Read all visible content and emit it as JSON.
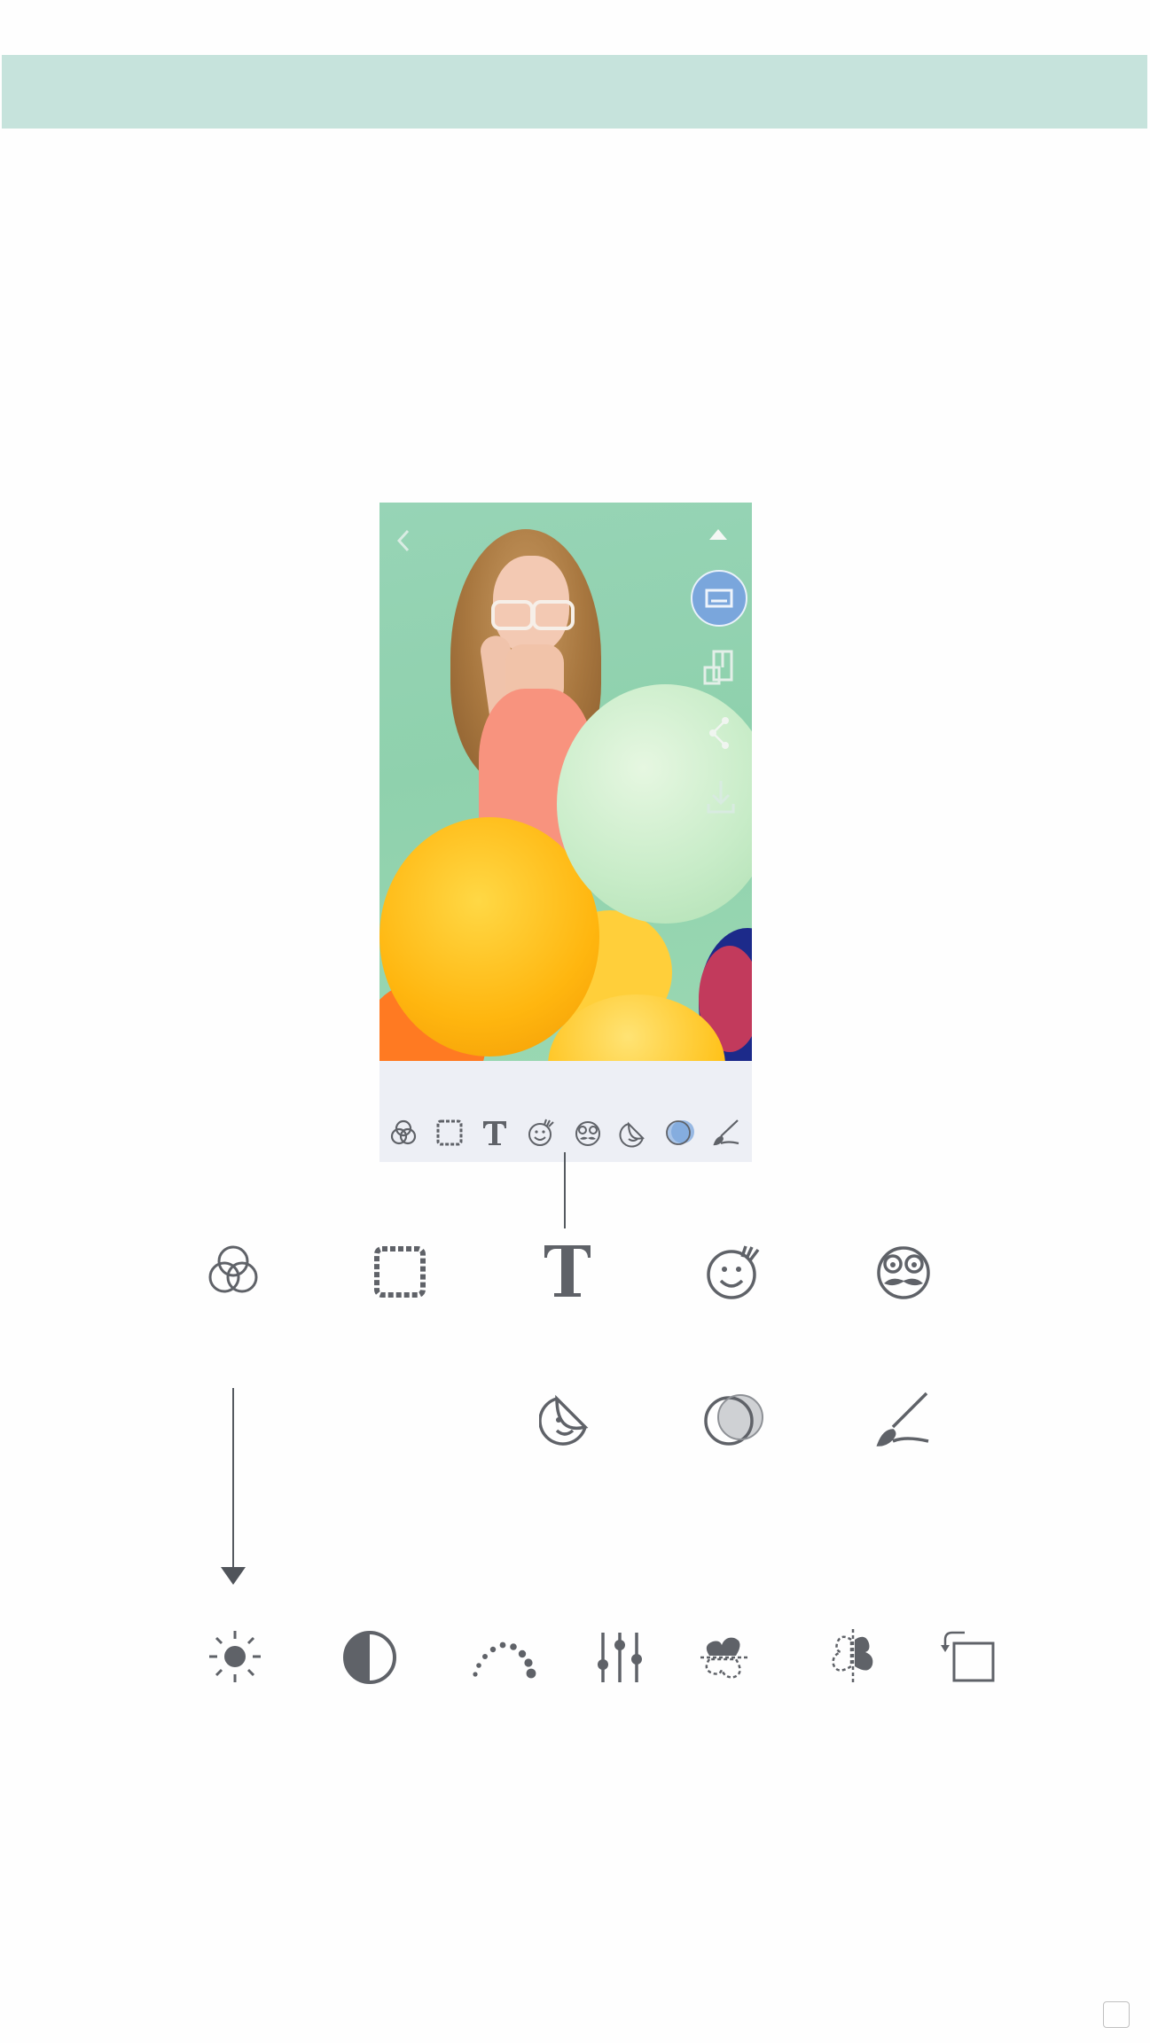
{
  "colors": {
    "header_band": "#c6e3dc",
    "icon_gray": "#5f6268",
    "accent_blue": "#7aa6dc"
  },
  "phone_screen": {
    "top_icons": [
      "back-chevron-icon",
      "expand-up-icon"
    ],
    "side_actions": [
      "print-icon",
      "collage-icon",
      "share-icon",
      "save-icon"
    ],
    "toolbar_icons": [
      "filter-icon",
      "border-icon",
      "text-icon",
      "sticker-icon",
      "face-sticker-icon",
      "peel-sticker-icon",
      "blend-icon",
      "brush-icon"
    ]
  },
  "tool_icons_row1": [
    "filter-icon",
    "border-icon",
    "text-icon",
    "sticker-icon",
    "face-sticker-icon"
  ],
  "tool_icons_row2": [
    "peel-sticker-icon",
    "blend-icon",
    "brush-icon"
  ],
  "adjust_icons": [
    "brightness-icon",
    "contrast-icon",
    "saturation-icon",
    "sliders-icon",
    "flip-vertical-icon",
    "flip-horizontal-icon",
    "rotate-icon"
  ]
}
